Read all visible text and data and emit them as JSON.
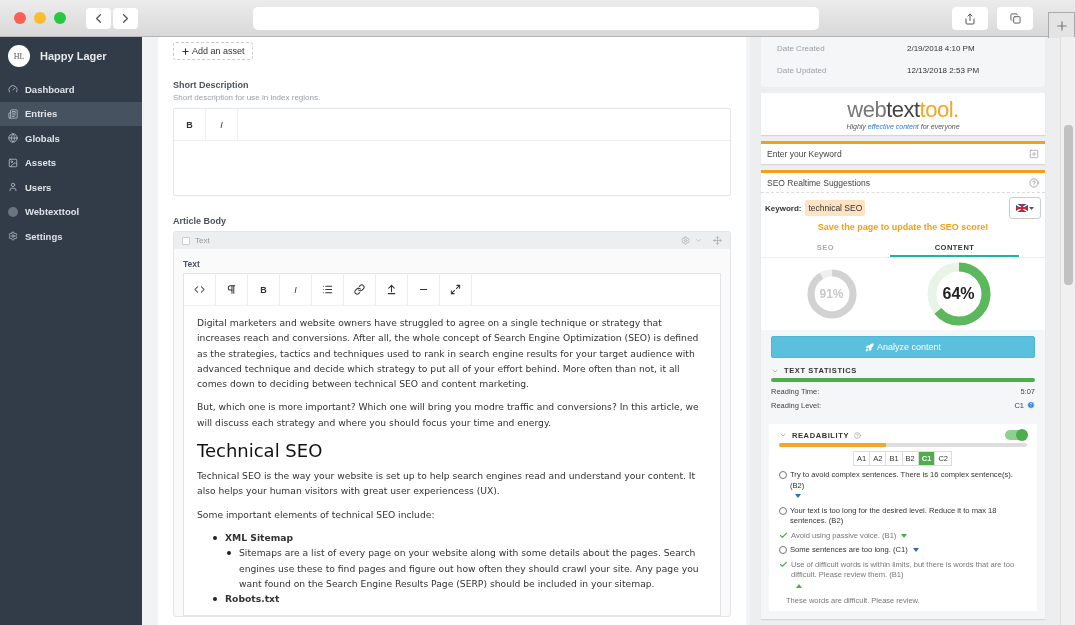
{
  "sidebar": {
    "logo_text": "HL",
    "site_name": "Happy Lager",
    "items": [
      {
        "label": "Dashboard",
        "selected": false
      },
      {
        "label": "Entries",
        "selected": true
      },
      {
        "label": "Globals",
        "selected": false
      },
      {
        "label": "Assets",
        "selected": false
      },
      {
        "label": "Users",
        "selected": false
      },
      {
        "label": "Webtexttool",
        "selected": false
      },
      {
        "label": "Settings",
        "selected": false
      }
    ]
  },
  "main": {
    "add_asset": "Add an asset",
    "short_description": {
      "label": "Short Description",
      "hint": "Short description for use in index regions.",
      "toolbar": [
        "B",
        "I"
      ]
    },
    "article_body": {
      "label": "Article Body",
      "block_title": "Text",
      "block_checked": false,
      "field_label": "Text",
      "toolbar": [
        "B",
        "I"
      ],
      "blocks": [
        {
          "kind": "p",
          "text": "Digital marketers and website owners have struggled to agree on a single technique or strategy that increases reach and conversions. After all, the whole concept of Search Engine Optimization (SEO) is defined as the strategies, tactics and techniques used to rank in search engine results for your target audience with advanced technique and decide which strategy to put all of your effort behind. More often than not, it all comes down to deciding between technical SEO and content marketing."
        },
        {
          "kind": "p",
          "text": "But, which one is more important? Which one will bring you modre traffic and conversions? In this article, we will discuss each strategy and where you should focus your time and energy."
        },
        {
          "kind": "h2",
          "text": "Technical SEO"
        },
        {
          "kind": "p",
          "text": "Technical SEO is the way your website is set up to help search engines read and understand your content. It also helps your human visitors with great user experiencess (UX)."
        },
        {
          "kind": "p",
          "text": "Some important elements of technical SEO include:"
        },
        {
          "kind": "list",
          "items": [
            {
              "text": "XML Sitemap",
              "children": [
                {
                  "text": "Sitemaps are a list of every page on your website along with some details about the pages. Search engines use these to find pages and figure out how often they should crawl your site. Any page you want found on the Search Engine Results Page (SERP) should be included in your sitemap."
                }
              ]
            },
            {
              "text": "Robots.txt"
            }
          ]
        }
      ]
    }
  },
  "meta": [
    {
      "label": "Date Created",
      "value": "2/19/2018 4:10 PM"
    },
    {
      "label": "Date Updated",
      "value": "12/13/2018 2:53 PM"
    }
  ],
  "webtexttool": {
    "logo": [
      "web",
      "text",
      "tool."
    ],
    "tagline": "Highly ",
    "tagline_link": "effective content",
    "tagline_end": " for everyone",
    "keyword_placeholder": "Enter your Keyword",
    "suggestions_title": "SEO Realtime Suggestions",
    "keyword_label": "Keyword:",
    "keyword": "technical SEO",
    "notice": "Save the page to update the SEO score!",
    "tabs": [
      {
        "label": "SEO",
        "selected": false
      },
      {
        "label": "CONTENT",
        "selected": true
      }
    ],
    "scores": [
      {
        "value": "91%",
        "level": 0.91
      },
      {
        "value": "64%",
        "level": 0.64
      }
    ],
    "analyze_button": "Analyze content",
    "text_statistics": {
      "title": "TEXT STATISTICS",
      "level": 1,
      "rows": [
        {
          "label": "Reading Time:",
          "value": "5:07",
          "help": false
        },
        {
          "label": "Reading Level:",
          "value": "C1",
          "help": true
        }
      ]
    },
    "readability": {
      "title": "READABILITY",
      "on": true,
      "level": 0.43,
      "levels": [
        {
          "label": "A1",
          "selected": false
        },
        {
          "label": "A2",
          "selected": false
        },
        {
          "label": "B1",
          "selected": false
        },
        {
          "label": "B2",
          "selected": false
        },
        {
          "label": "C1",
          "selected": true
        },
        {
          "label": "C2",
          "selected": false
        }
      ],
      "items": [
        {
          "kind": "open",
          "text": "Try to avoid complex sentences. There is 16 complex sentence(s). (B2)",
          "expanded": false
        },
        {
          "kind": "open",
          "text": "Your text is too long for the desired level. Reduce it to max 18 sentences. (B2)"
        },
        {
          "kind": "passed",
          "text": "Avoid using passive voice. (B1)",
          "expanded": false
        },
        {
          "kind": "open",
          "text": "Some sentences are too long. (C1)",
          "expanded": false
        },
        {
          "kind": "passed",
          "text": "Use of difficult words is within limits, but there is words that are too difficult. Please review them. (B1)",
          "expanded": true,
          "detail": "These words are difficult. Please review."
        }
      ]
    }
  }
}
